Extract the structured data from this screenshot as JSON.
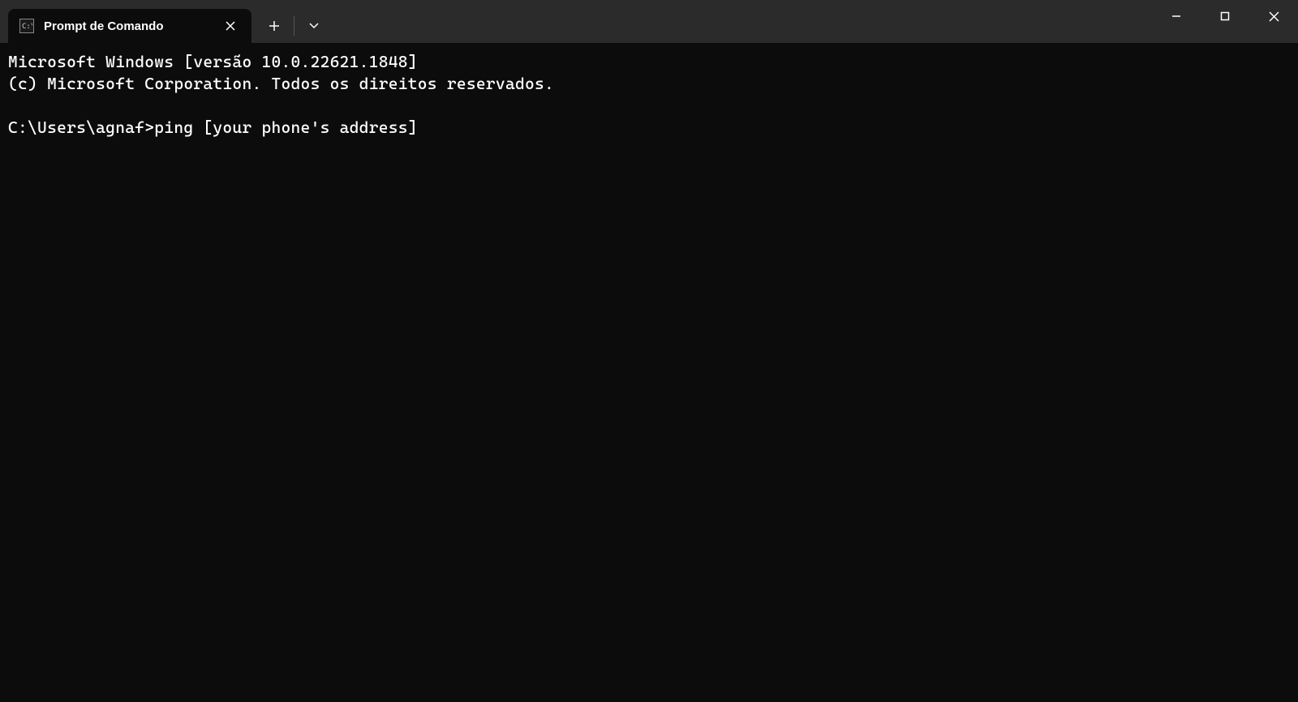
{
  "tab": {
    "title": "Prompt de Comando"
  },
  "terminal": {
    "line1": "Microsoft Windows [versão 10.0.22621.1848]",
    "line2": "(c) Microsoft Corporation. Todos os direitos reservados.",
    "prompt": "C:\\Users\\agnaf>",
    "command": "ping [your phone's address]"
  }
}
